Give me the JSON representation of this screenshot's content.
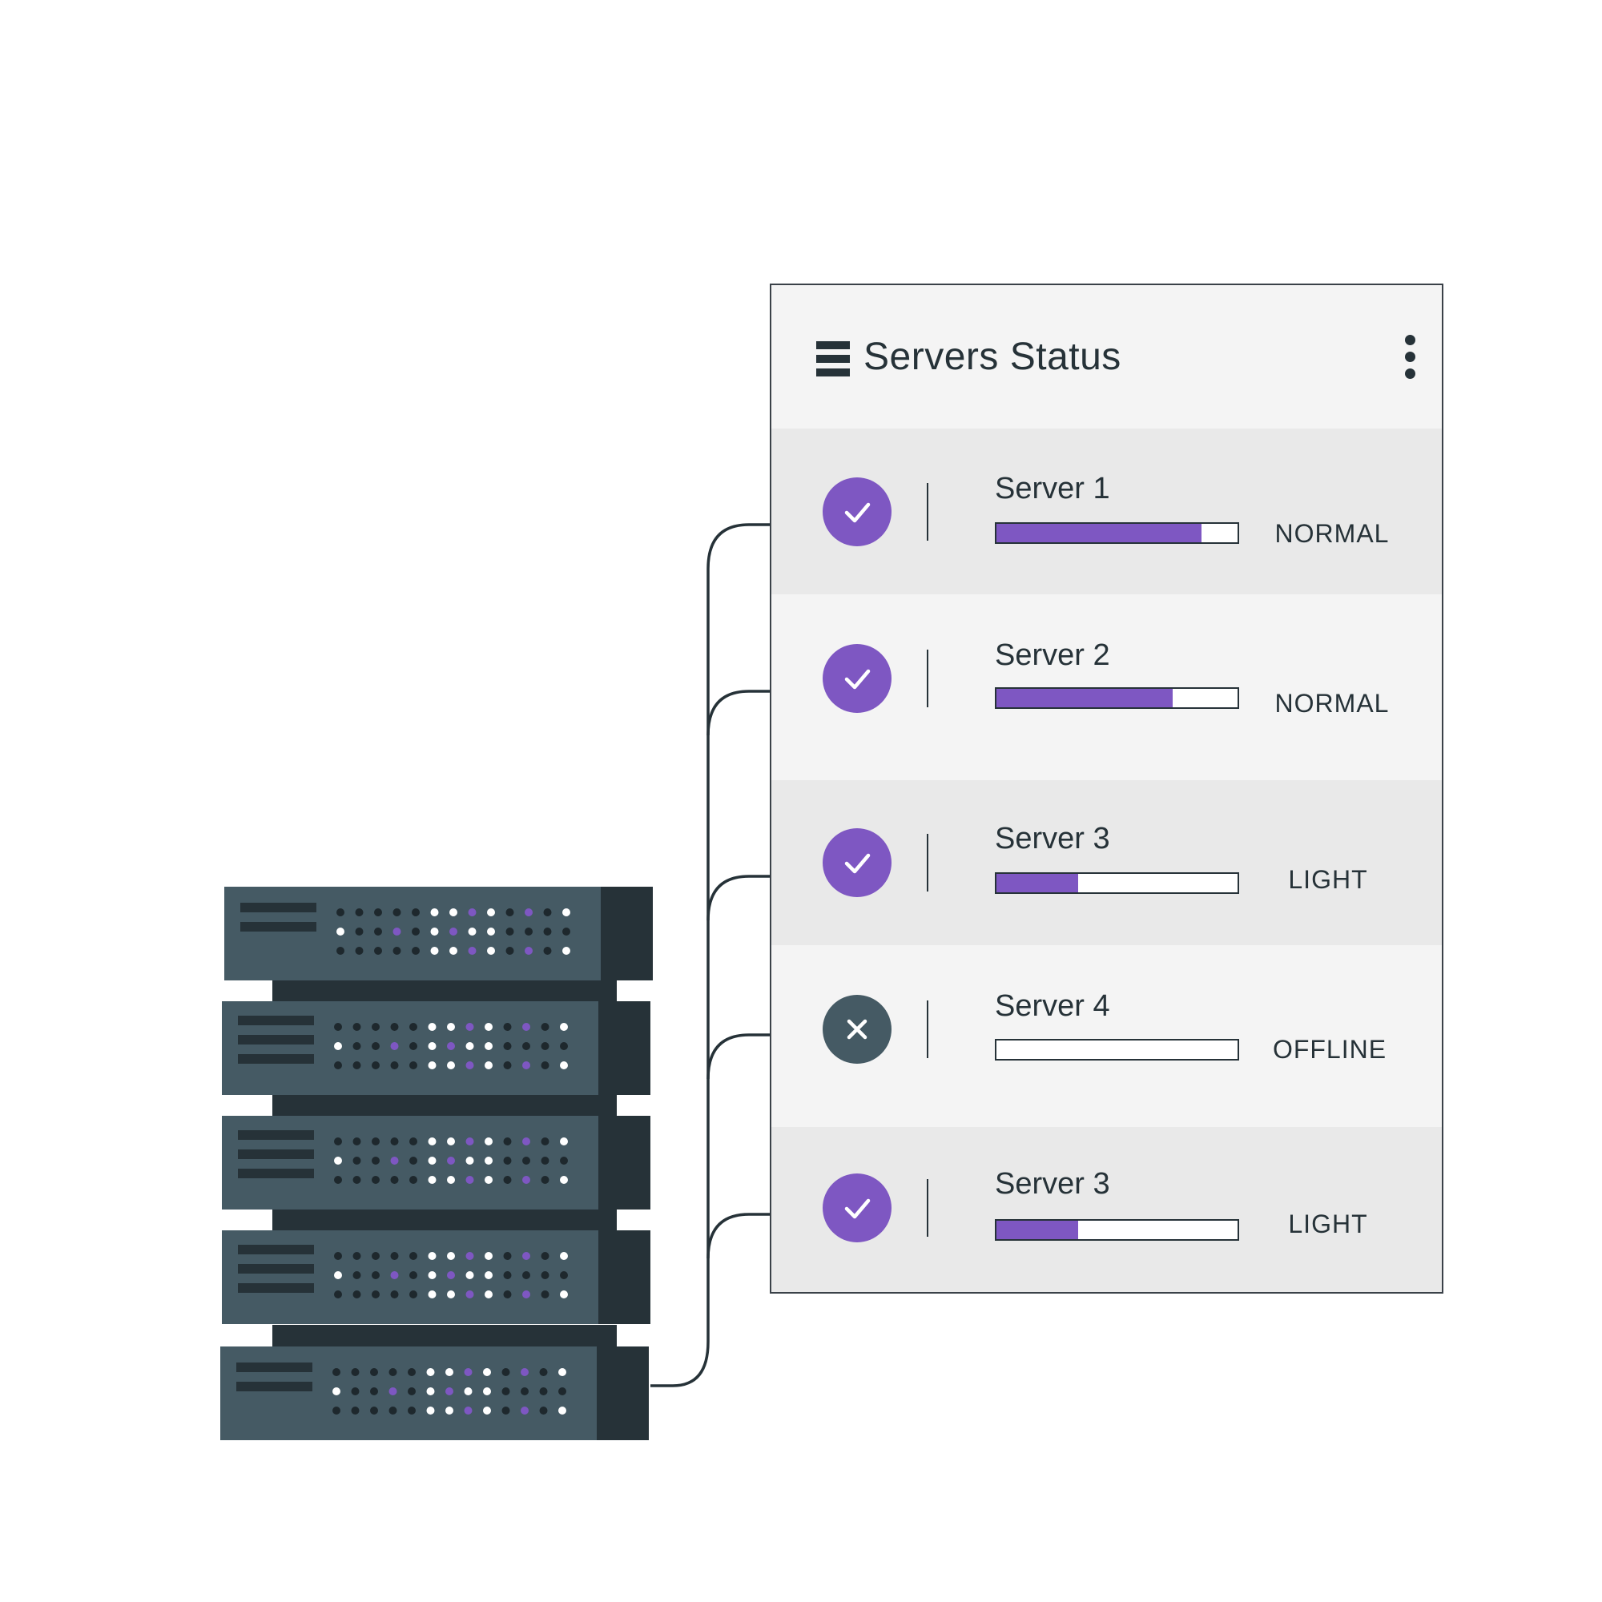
{
  "panel": {
    "title": "Servers Status",
    "title_icon": "server-list-icon",
    "menu_icon": "kebab-menu-icon"
  },
  "servers": [
    {
      "name": "Server 1",
      "status": "NORMAL",
      "load": 0.85,
      "state": "online",
      "icon": "check-icon"
    },
    {
      "name": "Server 2",
      "status": "NORMAL",
      "load": 0.73,
      "state": "online",
      "icon": "check-icon"
    },
    {
      "name": "Server 3",
      "status": "LIGHT",
      "load": 0.34,
      "state": "online",
      "icon": "check-icon"
    },
    {
      "name": "Server 4",
      "status": "OFFLINE",
      "load": 0.0,
      "state": "offline",
      "icon": "close-icon"
    },
    {
      "name": "Server 3",
      "status": "LIGHT",
      "load": 0.34,
      "state": "online",
      "icon": "check-icon"
    }
  ],
  "colors": {
    "accent": "#7e57c2",
    "dark": "#263238",
    "offline": "#455a64",
    "rack_face": "#455a64",
    "rack_dark": "#263238",
    "panel_bg": "#f4f4f4",
    "row_shade": "#e9e9e9"
  }
}
